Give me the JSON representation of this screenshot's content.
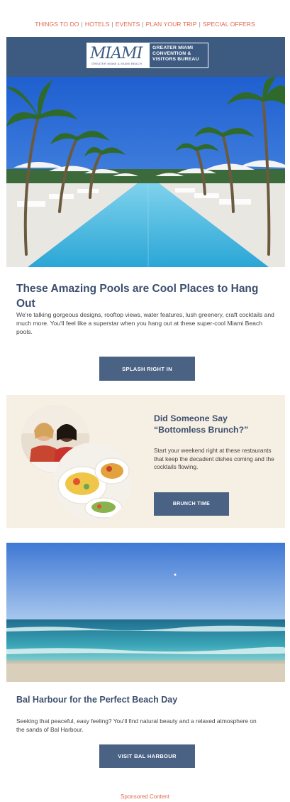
{
  "nav": {
    "items": [
      "THINGS TO DO",
      "HOTELS",
      "EVENTS",
      "PLAN YOUR TRIP",
      "SPECIAL OFFERS"
    ],
    "separator": "|",
    "color": "#e0694f"
  },
  "header": {
    "logo_script": "MIAMI",
    "logo_tagline": "GREATER MIAMI & MIAMI BEACH",
    "logo_lines": [
      "GREATER MIAMI",
      "CONVENTION &",
      "VISITORS BUREAU"
    ],
    "color": "#3d5a80"
  },
  "pools": {
    "title": "These Amazing Pools are Cool Places to Hang Out",
    "body": "We're talking gorgeous designs, rooftop views, water features, lush greenery, craft cocktails and much more. You'll feel like a superstar when you hang out at these super-cool Miami Beach pools.",
    "button": "SPLASH RIGHT IN"
  },
  "brunch": {
    "title": "Did Someone Say “Bottomless Brunch?”",
    "body": "Start your weekend right at these restaurants that keep the decadent dishes coming and the cocktails flowing.",
    "button": "BRUNCH TIME"
  },
  "beach": {
    "title": "Bal Harbour for the Perfect Beach Day",
    "body": "Seeking that peaceful, easy feeling? You'll find natural beauty and a relaxed atmosphere on the sands of Bal Harbour.",
    "button": "VISIT BAL HARBOUR"
  },
  "footer": {
    "sponsored": "Sponsored Content"
  }
}
